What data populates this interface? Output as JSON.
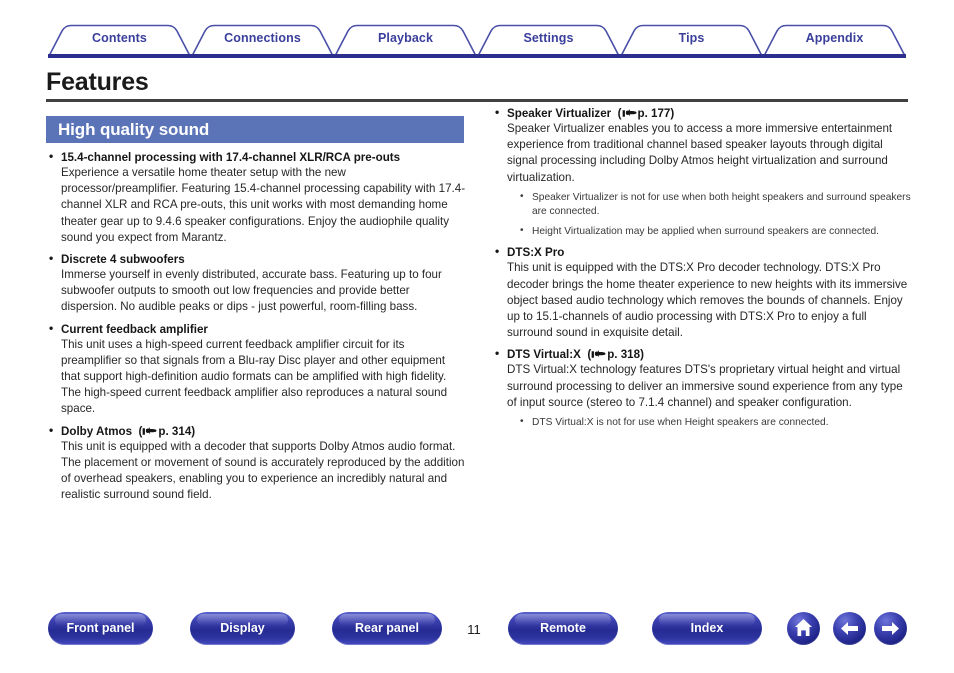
{
  "tabs": [
    {
      "label": "Contents"
    },
    {
      "label": "Connections"
    },
    {
      "label": "Playback"
    },
    {
      "label": "Settings"
    },
    {
      "label": "Tips"
    },
    {
      "label": "Appendix"
    }
  ],
  "page": {
    "title": "Features",
    "section_heading": "High quality sound",
    "number": "11"
  },
  "colors": {
    "tab_text": "#3a3f9c",
    "tab_border": "#4a50a8",
    "rule_dark": "#2d2f8f",
    "title_rule": "#404040",
    "section_bar": "#5b74b8",
    "button_blue": "#2a2f9c"
  },
  "left_column": [
    {
      "title": "15.4-channel processing with 17.4-channel XLR/RCA pre-outs",
      "body": "Experience a versatile home theater setup with the new processor/preamplifier. Featuring 15.4-channel processing capability with 17.4-channel XLR and RCA pre-outs, this unit works with most demanding home theater gear up to 9.4.6 speaker configurations. Enjoy the audiophile quality sound you expect from Marantz."
    },
    {
      "title": "Discrete 4 subwoofers",
      "body": "Immerse yourself in evenly distributed, accurate bass. Featuring up to four subwoofer outputs to smooth out low frequencies and provide better dispersion. No audible peaks or dips - just powerful, room-filling bass."
    },
    {
      "title": "Current feedback amplifier",
      "body": "This unit uses a high-speed current feedback amplifier circuit for its preamplifier so that signals from a Blu-ray Disc player and other equipment that support high-definition audio formats can be amplified with high fidelity. The high-speed current feedback amplifier also reproduces a natural sound space."
    },
    {
      "title": "Dolby Atmos",
      "ref_open": "(",
      "ref_icon": "pointing-hand-icon",
      "ref_text": "p. 314",
      "ref_close": ")",
      "body": "This unit is equipped with a decoder that supports Dolby Atmos audio format. The placement or movement of sound is accurately reproduced by the addition of overhead speakers, enabling you to experience an incredibly natural and realistic surround sound field."
    }
  ],
  "right_column": [
    {
      "title": "Speaker Virtualizer",
      "ref_open": "(",
      "ref_icon": "pointing-hand-icon",
      "ref_text": "p. 177",
      "ref_close": ")",
      "body": "Speaker Virtualizer enables you to access a more immersive entertainment experience from traditional channel based speaker layouts through digital signal processing including Dolby Atmos height virtualization and surround virtualization.",
      "notes": [
        "Speaker Virtualizer is not for use when both height speakers and surround speakers are connected.",
        "Height Virtualization may be applied when surround speakers are connected."
      ]
    },
    {
      "title": "DTS:X Pro",
      "body": "This unit is equipped with the DTS:X Pro decoder technology. DTS:X Pro decoder brings the home theater experience to new heights with its immersive object based audio technology which removes the bounds of channels. Enjoy up to 15.1-channels of audio processing with DTS:X Pro to enjoy a full surround sound in exquisite detail."
    },
    {
      "title": "DTS Virtual:X",
      "ref_open": "(",
      "ref_icon": "pointing-hand-icon",
      "ref_text": "p. 318",
      "ref_close": ")",
      "body": "DTS Virtual:X technology features DTS's proprietary virtual height and virtual surround processing to deliver an immersive sound experience from any type of input source (stereo to 7.1.4 channel) and speaker configuration.",
      "notes": [
        "DTS Virtual:X is not for use when Height speakers are connected."
      ]
    }
  ],
  "footer": {
    "buttons": [
      {
        "label": "Front panel"
      },
      {
        "label": "Display"
      },
      {
        "label": "Rear panel"
      },
      {
        "label": "Remote"
      },
      {
        "label": "Index"
      }
    ],
    "icons": [
      {
        "name": "home-icon"
      },
      {
        "name": "arrow-left-icon"
      },
      {
        "name": "arrow-right-icon"
      }
    ]
  }
}
